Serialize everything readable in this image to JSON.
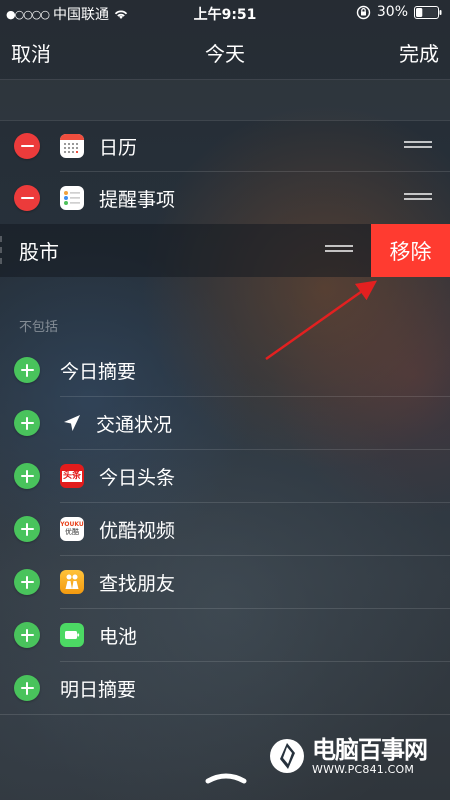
{
  "status_bar": {
    "signal": "●○○○○",
    "carrier": "中国联通",
    "time": "上午9:51",
    "battery_percent": "30%",
    "battery_level": 0.3
  },
  "nav": {
    "cancel_label": "取消",
    "title": "今天",
    "done_label": "完成"
  },
  "included": [
    {
      "label": "日历",
      "icon": "calendar-icon"
    },
    {
      "label": "提醒事项",
      "icon": "reminders-icon"
    }
  ],
  "swiped_item": {
    "label": "股市",
    "action_label": "移除"
  },
  "section_excluded_label": "不包括",
  "excluded": [
    {
      "label": "今日摘要",
      "icon": ""
    },
    {
      "label": "交通状况",
      "icon": "location-arrow-icon"
    },
    {
      "label": "今日头条",
      "icon": "toutiao-icon",
      "icon_text": "头条"
    },
    {
      "label": "优酷视频",
      "icon": "youku-icon",
      "icon_text_top": "YOUKU",
      "icon_text_bottom": "优酷"
    },
    {
      "label": "查找朋友",
      "icon": "find-friends-icon"
    },
    {
      "label": "电池",
      "icon": "battery-widget-icon"
    },
    {
      "label": "明日摘要",
      "icon": ""
    }
  ],
  "watermark": {
    "title": "电脑百事网",
    "url": "WWW.PC841.COM"
  },
  "colors": {
    "remove_red": "#ec3b3b",
    "add_green": "#49c35c",
    "action_red": "#ff3b30",
    "arrow_red": "#e32020"
  }
}
